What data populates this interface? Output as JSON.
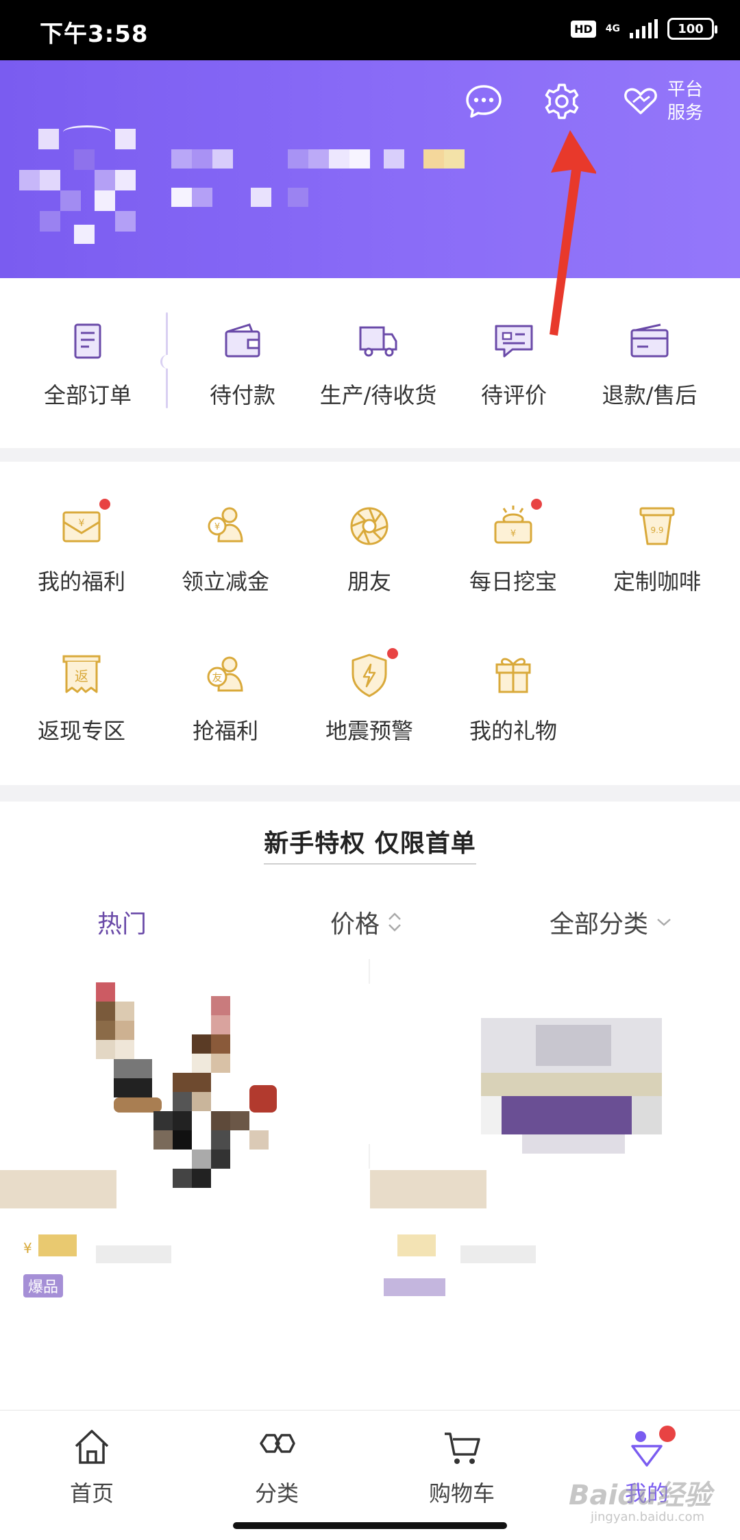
{
  "status_bar": {
    "time": "下午3:58",
    "hd": "HD",
    "network": "4G",
    "battery": "100"
  },
  "header": {
    "platform_service": "平台\n服务",
    "platform_line1": "平台",
    "platform_line2": "服务"
  },
  "orders": {
    "items": [
      {
        "label": "全部订单",
        "icon": "all-orders-icon"
      },
      {
        "label": "待付款",
        "icon": "wallet-icon"
      },
      {
        "label": "生产/待收货",
        "icon": "truck-icon"
      },
      {
        "label": "待评价",
        "icon": "review-icon"
      },
      {
        "label": "退款/售后",
        "icon": "refund-card-icon"
      }
    ]
  },
  "services": {
    "items": [
      {
        "label": "我的福利",
        "icon": "envelope-yen-icon",
        "badge": true
      },
      {
        "label": "领立减金",
        "icon": "coupon-people-icon",
        "badge": false
      },
      {
        "label": "朋友",
        "icon": "aperture-icon",
        "badge": false
      },
      {
        "label": "每日挖宝",
        "icon": "treasure-icon",
        "badge": true
      },
      {
        "label": "定制咖啡",
        "icon": "coffee-cup-icon",
        "badge": false
      },
      {
        "label": "返现专区",
        "icon": "cashback-icon",
        "badge": false
      },
      {
        "label": "抢福利",
        "icon": "friend-people-icon",
        "badge": false
      },
      {
        "label": "地震预警",
        "icon": "shield-bolt-icon",
        "badge": true
      },
      {
        "label": "我的礼物",
        "icon": "gift-icon",
        "badge": false
      }
    ]
  },
  "products": {
    "title": "新手特权 仅限首单",
    "filters": {
      "hot": "热门",
      "price": "价格",
      "category": "全部分类"
    },
    "price_symbol": "¥",
    "badge": "爆品"
  },
  "bottom_nav": {
    "items": [
      {
        "label": "首页",
        "icon": "home-icon"
      },
      {
        "label": "分类",
        "icon": "category-hex-icon"
      },
      {
        "label": "购物车",
        "icon": "cart-icon"
      },
      {
        "label": "我的",
        "icon": "profile-triangle-icon"
      }
    ]
  },
  "watermark": {
    "brand": "Baidu经验",
    "url": "jingyan.baidu.com"
  },
  "colors": {
    "brand_purple": "#7a5cf0",
    "icon_gold": "#d9a93a",
    "badge_red": "#e84343",
    "arrow_red": "#e8392b"
  }
}
